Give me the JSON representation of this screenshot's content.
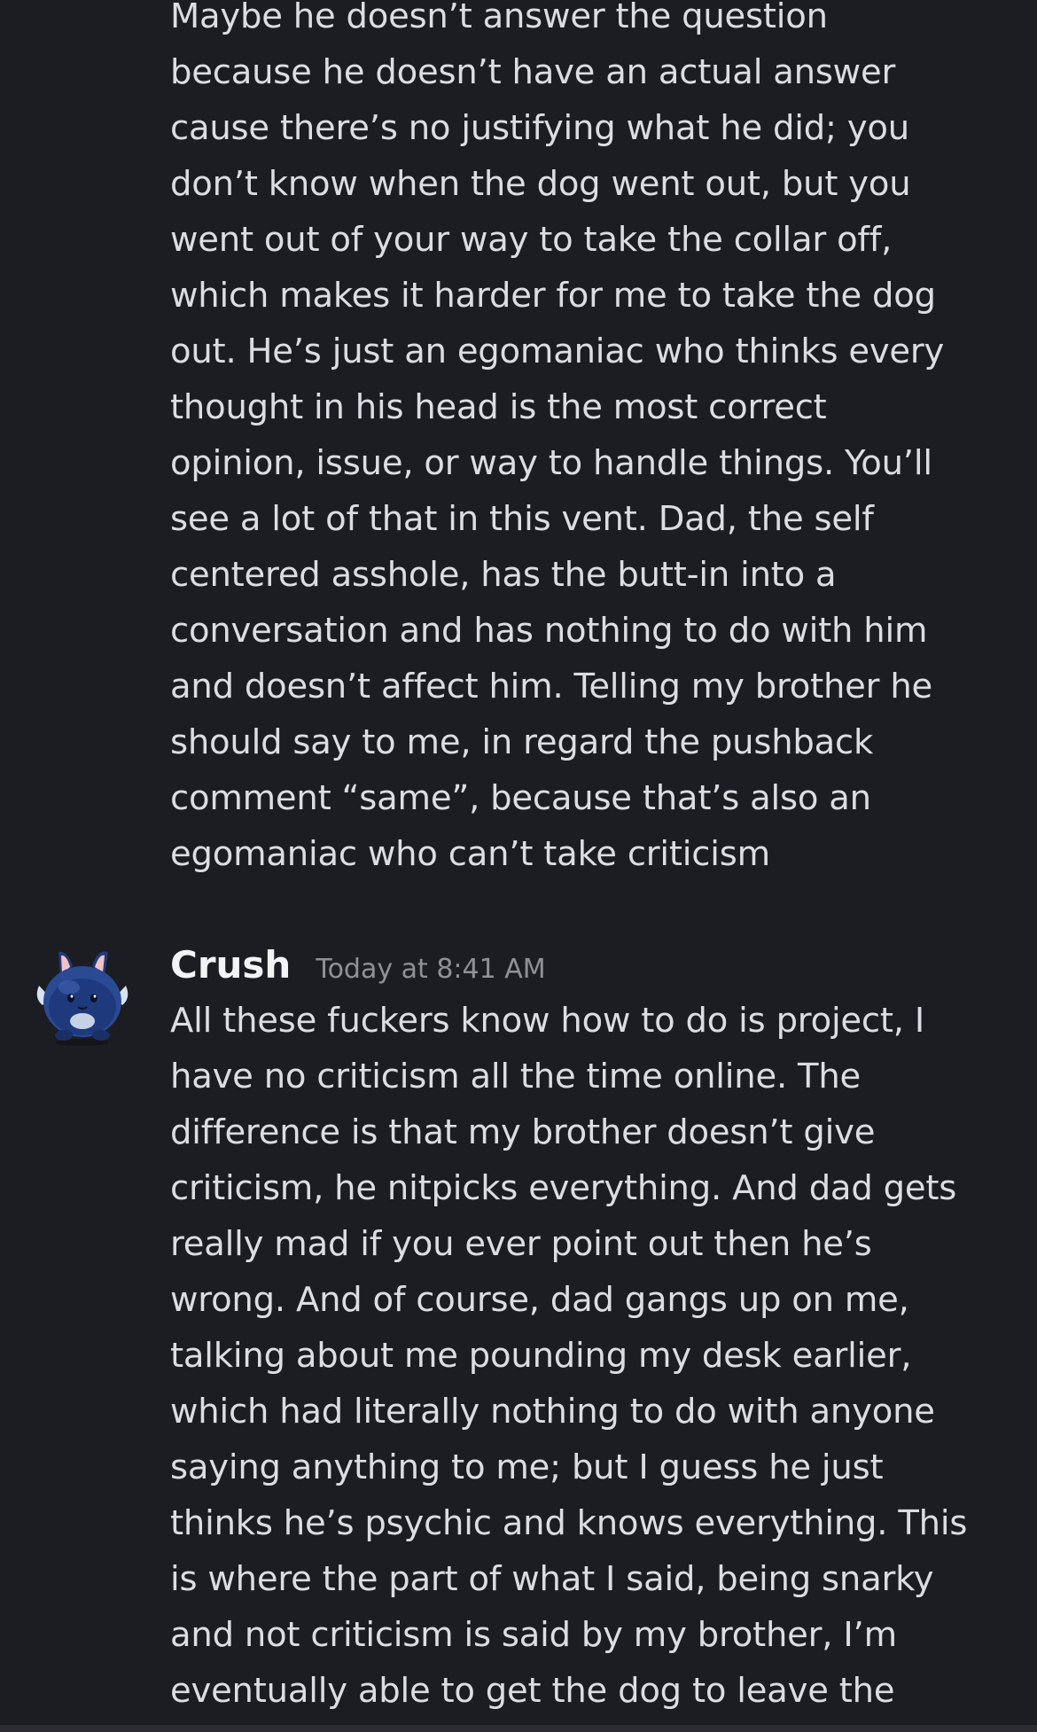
{
  "messages": {
    "continued": {
      "lines": [
        "Maybe he doesn’t answer the question",
        "because he doesn’t have an actual answer",
        "cause there’s no justifying what he did; you",
        "don’t know when the dog went out, but you",
        "went out of your way to take the collar off,",
        "which makes it harder for me to take the dog",
        "out. He’s just an egomaniac who thinks every",
        "thought in his head is the most correct",
        "opinion, issue, or way to handle things. You’ll",
        "see a lot of that in this vent. Dad, the self",
        "centered asshole, has the butt-in into a",
        "conversation and has nothing to do with him",
        "and doesn’t affect him. Telling my brother he",
        "should say to me, in regard the pushback",
        "comment “same”, because that’s also an",
        "egomaniac who can’t take criticism"
      ]
    },
    "latest": {
      "author": "Crush",
      "timestamp": "Today at 8:41 AM",
      "lines": [
        "All these fuckers know how to do is project, I",
        "have no criticism all the time online. The",
        "difference is that my brother doesn’t give",
        "criticism, he nitpicks everything. And dad gets",
        "really mad if you ever point out then he’s",
        "wrong. And of course, dad gangs up on me,",
        "talking about me pounding my desk earlier,",
        "which had literally nothing to do with anyone",
        "saying anything to me; but I guess he just",
        "thinks he’s psychic and knows everything. This",
        "is where the part of what I said, being snarky",
        "and not criticism is said by my brother, I’m",
        "eventually able to get the dog to leave the"
      ]
    }
  },
  "colors": {
    "background": "#1c1d22",
    "text": "#dbdee1",
    "username": "#f2f3f5",
    "timestamp": "#8e9297"
  }
}
